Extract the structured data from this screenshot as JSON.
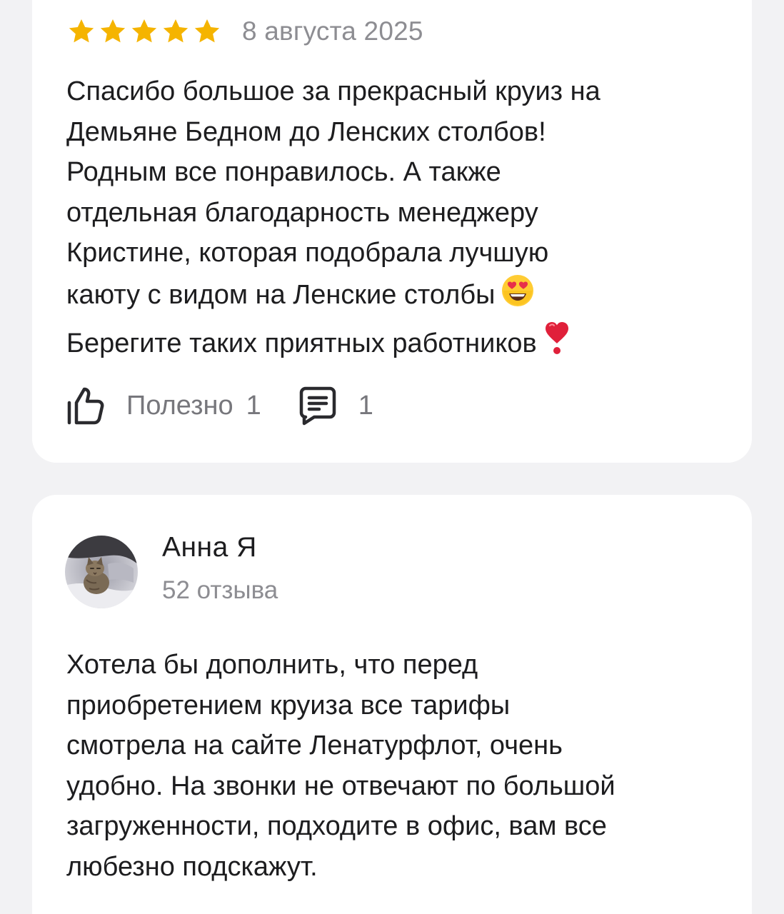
{
  "review_1": {
    "rating": 5,
    "rating_max": 5,
    "date": "8 августа 2025",
    "text_lines": [
      "Спасибо большое за прекрасный круиз на",
      "Демьяне Бедном до Ленских столбов!",
      "Родным все понравилось. А также",
      "отдельная благодарность менеджеру",
      "Кристине, которая подобрала лучшую",
      "каюту с видом на Ленские столбы",
      "Берегите таких приятных работников"
    ],
    "emojis": {
      "line_6": "smiling-face-with-heart-eyes",
      "line_7": "red-heart-exclamation"
    },
    "actions": {
      "helpful_label": "Полезно",
      "helpful_count": "1",
      "comments_count": "1"
    }
  },
  "review_2": {
    "author_name": "Анна Я",
    "author_reviews": "52 отзыва",
    "avatar": "cat-photo",
    "text_lines": [
      "Хотела бы дополнить, что перед",
      "приобретением круиза все тарифы",
      "смотрела на сайте Ленатурфлот, очень",
      "удобно. На звонки не отвечают по большой",
      "загруженности, подходите в офис, вам все",
      "любезно подскажут."
    ]
  },
  "colors": {
    "star": "#f5b400",
    "background": "#f2f2f4",
    "card": "#ffffff",
    "secondary_text": "#8d8d92",
    "action_gray": "#77777c"
  }
}
